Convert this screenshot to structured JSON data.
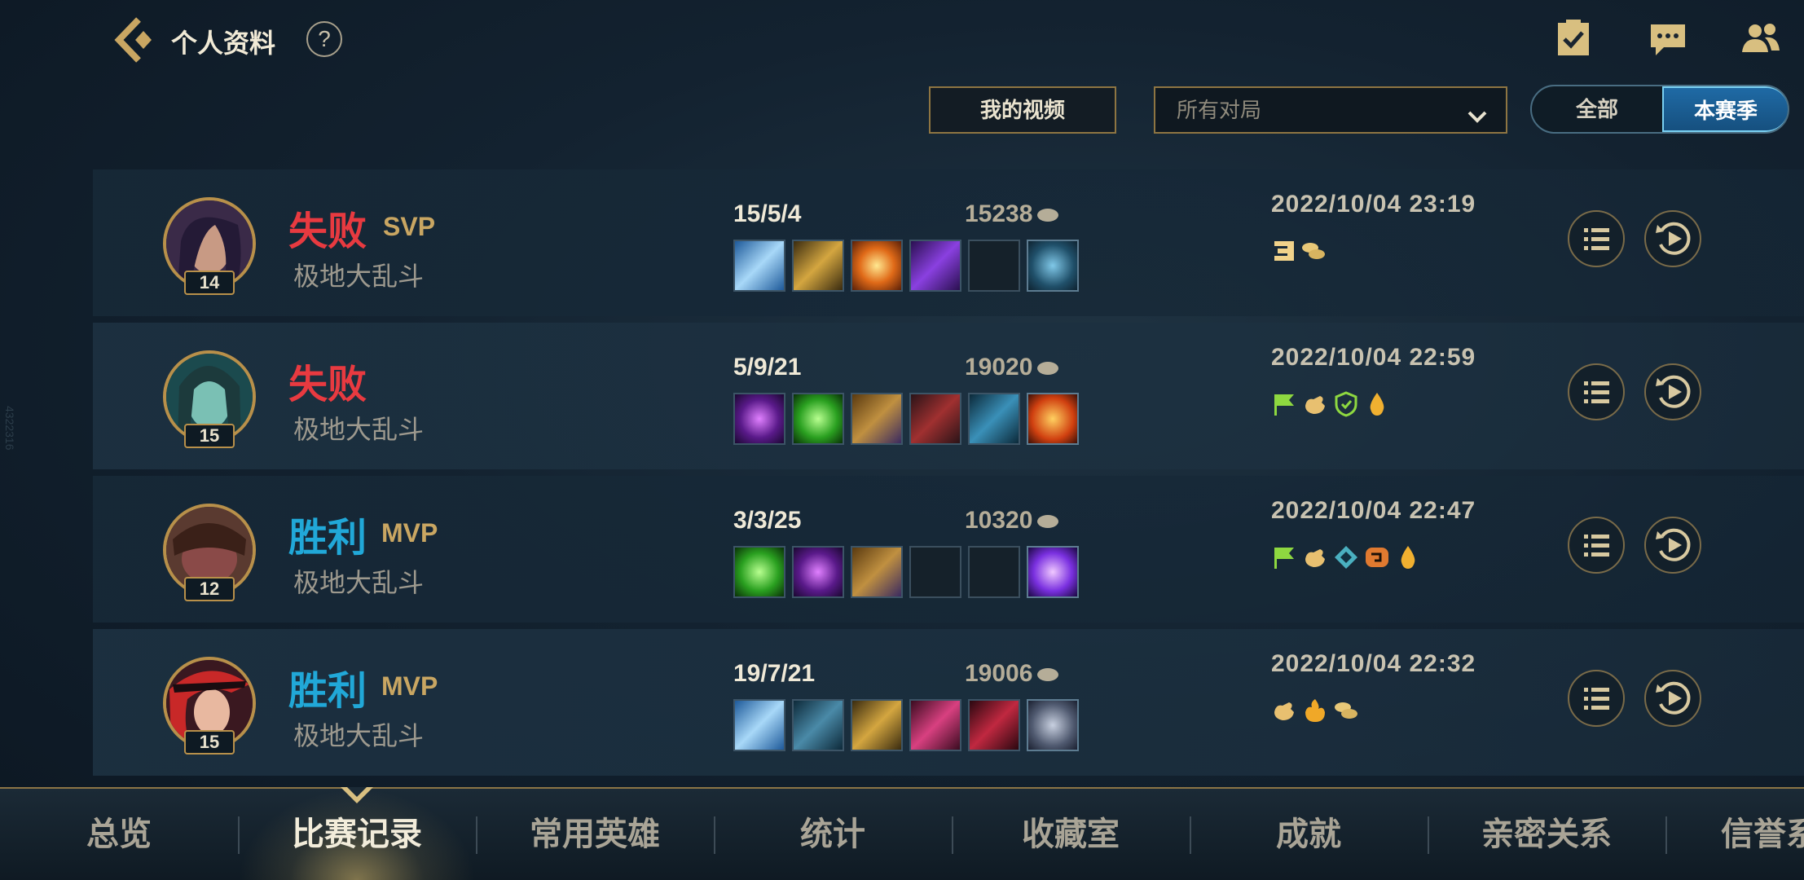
{
  "header": {
    "title": "个人资料",
    "help_glyph": "?"
  },
  "filters": {
    "video_button": "我的视频",
    "match_type_selected": "所有对局",
    "toggle_all": "全部",
    "toggle_season": "本赛季",
    "toggle_active": "本赛季"
  },
  "side_code": "4322316",
  "matches": [
    {
      "result": "失败",
      "result_type": "loss",
      "badge": "SVP",
      "mode": "极地大乱斗",
      "level": "14",
      "kda": "15/5/4",
      "gold": "15238",
      "timestamp": "2022/10/04 23:19",
      "items": [
        "blue-spear-item",
        "golden-blade-item",
        "sun-item",
        "purple-whip-item",
        "empty",
        "lantern-item"
      ],
      "badges": [
        "triple-kill-icon",
        "gold-coins-icon"
      ]
    },
    {
      "result": "失败",
      "result_type": "loss",
      "badge": "",
      "mode": "极地大乱斗",
      "level": "15",
      "kda": "5/9/21",
      "gold": "19020",
      "timestamp": "2022/10/04 22:59",
      "items": [
        "purple-crystal-item",
        "green-orb-item",
        "amber-staff-item",
        "dark-knight-item",
        "blue-armor-item",
        "fire-shield-item"
      ],
      "badges": [
        "flag-icon",
        "hand-icon",
        "shield-icon",
        "drop-icon"
      ]
    },
    {
      "result": "胜利",
      "result_type": "win",
      "badge": "MVP",
      "mode": "极地大乱斗",
      "level": "12",
      "kda": "3/3/25",
      "gold": "10320",
      "timestamp": "2022/10/04 22:47",
      "items": [
        "green-orb-item",
        "purple-crystal-item",
        "amber-staff-item",
        "empty",
        "empty",
        "purple-comet-item"
      ],
      "badges": [
        "flag-icon",
        "hand-icon",
        "shield-icon",
        "heal-icon",
        "drop-icon"
      ]
    },
    {
      "result": "胜利",
      "result_type": "win",
      "badge": "MVP",
      "mode": "极地大乱斗",
      "level": "15",
      "kda": "19/7/21",
      "gold": "19006",
      "timestamp": "2022/10/04 22:32",
      "items": [
        "blue-spear-item",
        "crossbow-item",
        "golden-blade-item",
        "pink-blade-item",
        "crimson-dagger-item",
        "ghost-poro-item"
      ],
      "badges": [
        "hand-icon",
        "fire-icon",
        "gold-coins-icon"
      ]
    }
  ],
  "tabs": [
    "总览",
    "比赛记录",
    "常用英雄",
    "统计",
    "收藏室",
    "成就",
    "亲密关系",
    "信誉系"
  ],
  "active_tab": "比赛记录",
  "colors": {
    "gold_accent": "#c9a662",
    "loss": "#e83a40",
    "win": "#21a8d8",
    "toggle_active": "#1f6aa5"
  }
}
